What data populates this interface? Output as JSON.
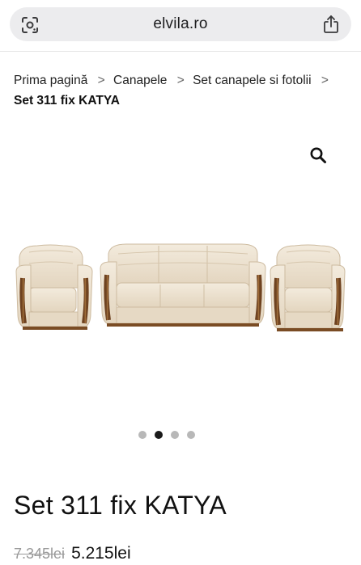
{
  "browser": {
    "url": "elvila.ro",
    "icons": {
      "left": "camera-lens-icon",
      "right": "share-icon"
    }
  },
  "breadcrumb": {
    "items": [
      {
        "label": "Prima pagină"
      },
      {
        "label": "Canapele"
      },
      {
        "label": "Set canapele si fotolii"
      }
    ],
    "current": "Set 311 fix KATYA",
    "separator": ">"
  },
  "gallery": {
    "search_icon": "search-icon",
    "image_subject": "sofa-set-image",
    "dots_count": 4,
    "active_dot": 1
  },
  "product": {
    "title": "Set 311 fix KATYA",
    "old_price": "7.345lei",
    "new_price": "5.215lei"
  },
  "colors": {
    "cream": "#efe4d2",
    "wood": "#8a5a2b",
    "active_dot": "#1a1a1a",
    "inactive_dot": "#b8b8b8"
  }
}
